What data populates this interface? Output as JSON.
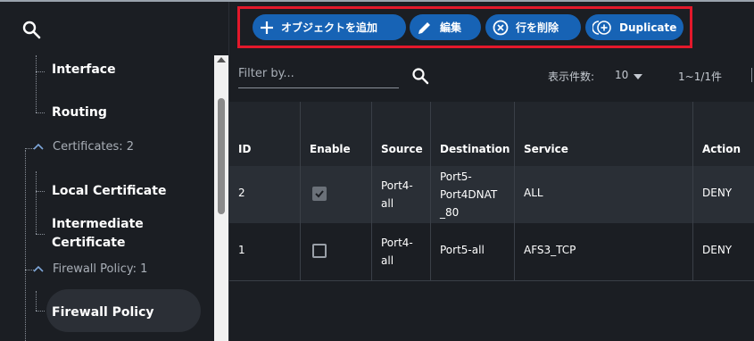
{
  "sidebar": {
    "search_icon": "search-icon",
    "items": [
      {
        "label": "Interface"
      },
      {
        "label": "Routing"
      },
      {
        "label": "Certificates: 2"
      },
      {
        "label": "Local Certificate"
      },
      {
        "label": "Intermediate"
      },
      {
        "label": "Certificate"
      },
      {
        "label": "Firewall Policy: 1"
      },
      {
        "label": "Firewall Policy"
      }
    ]
  },
  "toolbar": {
    "add_label": "オブジェクトを追加",
    "edit_label": "編集",
    "delete_label": "行を削除",
    "duplicate_label": "Duplicate"
  },
  "filter": {
    "placeholder": "Filter by..."
  },
  "pager": {
    "label": "表示件数:",
    "page_size": "10",
    "range": "1~1/1件"
  },
  "table": {
    "headers": [
      "ID",
      "Enable",
      "Source",
      "Destination",
      "Service",
      "Action"
    ],
    "rows": [
      {
        "id": "2",
        "enabled": true,
        "source": [
          "Port4-",
          "all"
        ],
        "destination": [
          "Port5-",
          "Port4DNAT",
          "_80"
        ],
        "service": "ALL",
        "action": "DENY"
      },
      {
        "id": "1",
        "enabled": false,
        "source": [
          "Port4-",
          "all"
        ],
        "destination": [
          "Port5-all"
        ],
        "service": "AFS3_TCP",
        "action": "DENY"
      }
    ]
  },
  "colors": {
    "accent": "#1763b5",
    "highlight_border": "#e3182b",
    "background": "#1b1e23"
  }
}
